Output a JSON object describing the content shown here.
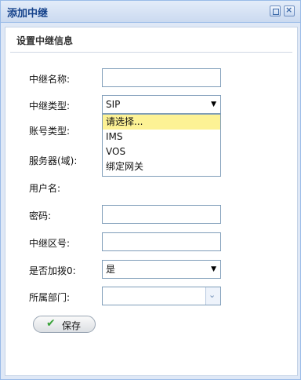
{
  "window": {
    "title": "添加中继"
  },
  "panel": {
    "title": "设置中继信息"
  },
  "form": {
    "name_label": "中继名称:",
    "name_value": "",
    "type_label": "中继类型:",
    "type_value": "SIP",
    "account_type_label": "账号类型:",
    "account_type_value": "",
    "account_type_options": [
      "请选择...",
      "IMS",
      "VOS",
      "绑定网关"
    ],
    "server_label": "服务器(域):",
    "username_label": "用户名:",
    "password_label": "密码:",
    "password_value": "",
    "area_code_label": "中继区号:",
    "area_code_value": "",
    "prefix_zero_label": "是否加拨0:",
    "prefix_zero_value": "是",
    "department_label": "所属部门:",
    "department_value": ""
  },
  "buttons": {
    "save": "保存"
  }
}
